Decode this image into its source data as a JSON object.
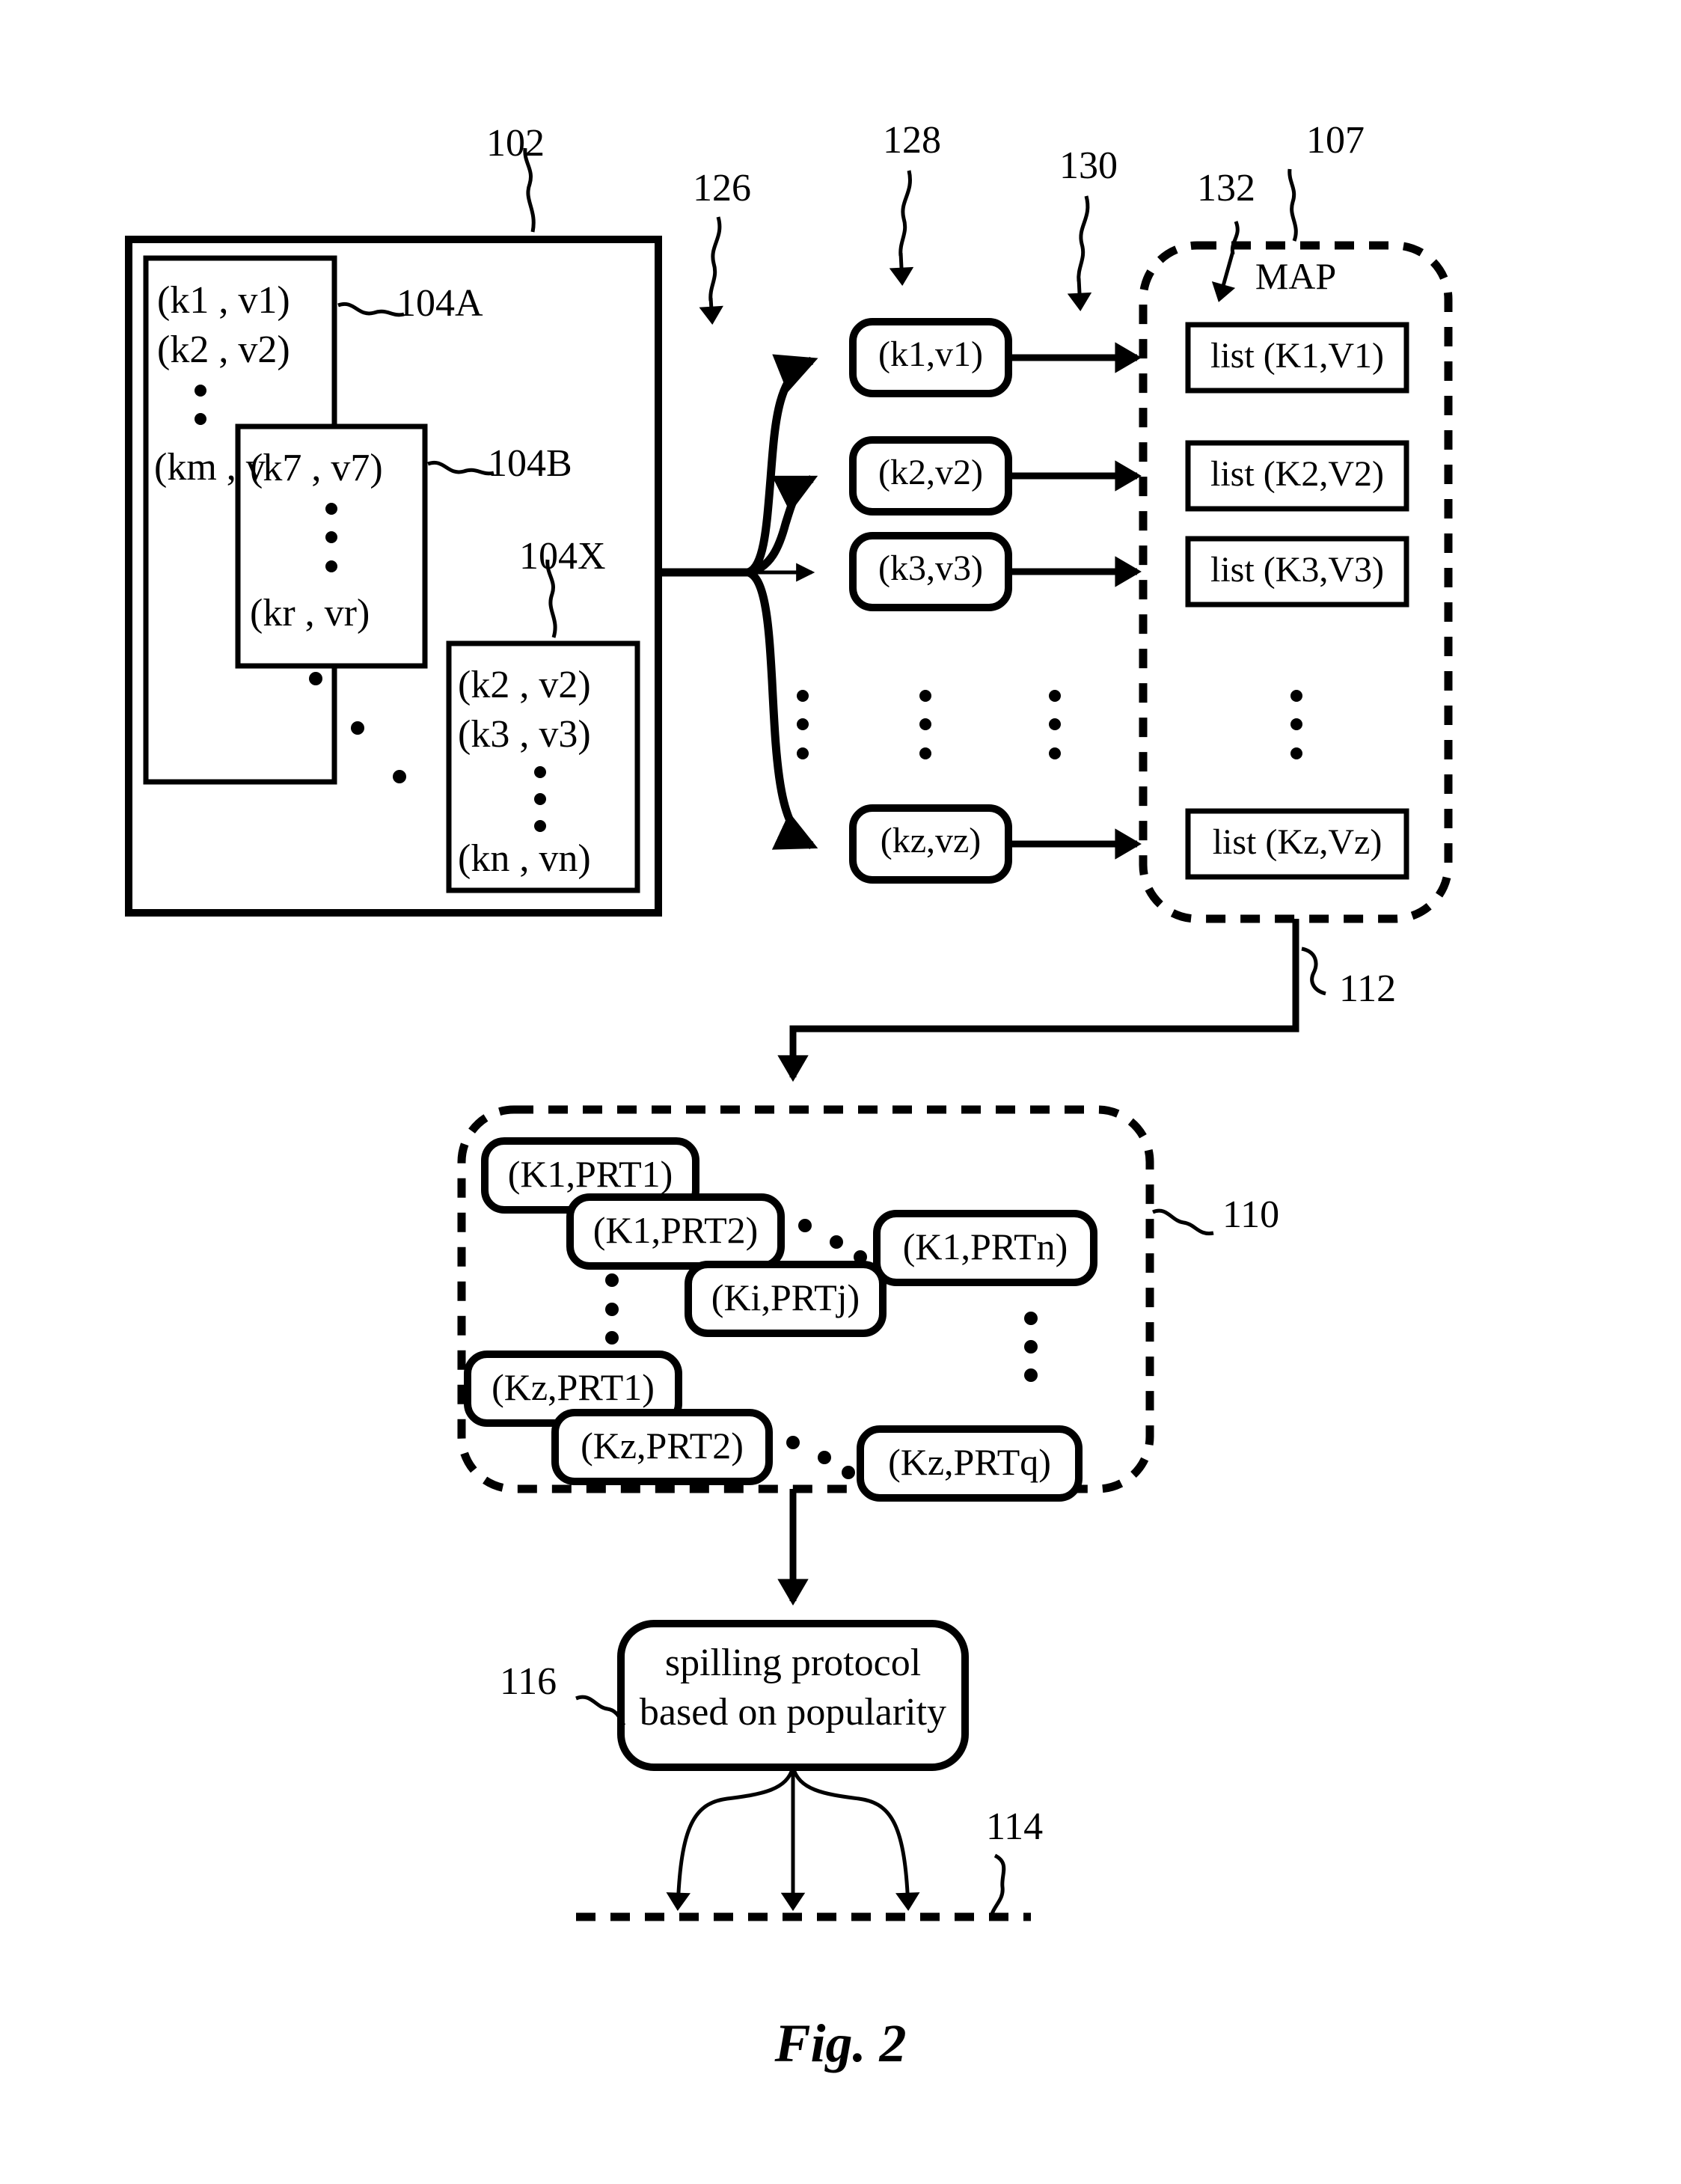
{
  "figure": {
    "caption": "Fig. 2",
    "domain_label": "patent-diagram"
  },
  "input_container": {
    "ref": "102",
    "splits": [
      {
        "ref": "104A",
        "entries": [
          "(k1 , v1)",
          "(k2 , v2)",
          "(km , vm)"
        ],
        "ellipsis_between": true
      },
      {
        "ref": "104B",
        "entries": [
          "(k7 , v7)",
          "(kr  , vr)"
        ],
        "ellipsis_between": true
      },
      {
        "ref": "104X",
        "entries": [
          "(k2 , v2)",
          "(k3 , v3)",
          "(kn , vn)"
        ],
        "ellipsis_between": true
      }
    ]
  },
  "fanout": {
    "ref": "126"
  },
  "emitted_pairs": {
    "ref": "128",
    "items": [
      {
        "label": "(k1,v1)"
      },
      {
        "label": "(k2,v2)"
      },
      {
        "label": "(k3,v3)"
      },
      {
        "label": "(kz,vz)"
      }
    ],
    "ellipsis": "⋮"
  },
  "pair_arrows": {
    "ref": "130"
  },
  "map": {
    "ref": "107",
    "boundary_ref": "132",
    "title": "MAP",
    "lists": [
      {
        "label": "list (K1,V1)"
      },
      {
        "label": "list (K2,V2)"
      },
      {
        "label": "list (K3,V3)"
      },
      {
        "label": "list (Kz,Vz)"
      }
    ]
  },
  "map_to_partitions": {
    "ref": "112"
  },
  "partitions": {
    "ref": "110",
    "rows": [
      {
        "key": "K1",
        "items": [
          "(K1,PRT1)",
          "(K1,PRT2)",
          "(K1,PRTn)"
        ]
      },
      {
        "key": "Ki",
        "items": [
          "(Ki,PRTj)"
        ]
      },
      {
        "key": "Kz",
        "items": [
          "(Kz,PRT1)",
          "(Kz,PRT2)",
          "(Kz,PRTq)"
        ]
      }
    ]
  },
  "spilling": {
    "ref": "116",
    "line1": "spilling protocol",
    "line2": "based on popularity"
  },
  "storage": {
    "ref": "114"
  },
  "colors": {
    "ink": "#000000",
    "paper": "#ffffff"
  }
}
